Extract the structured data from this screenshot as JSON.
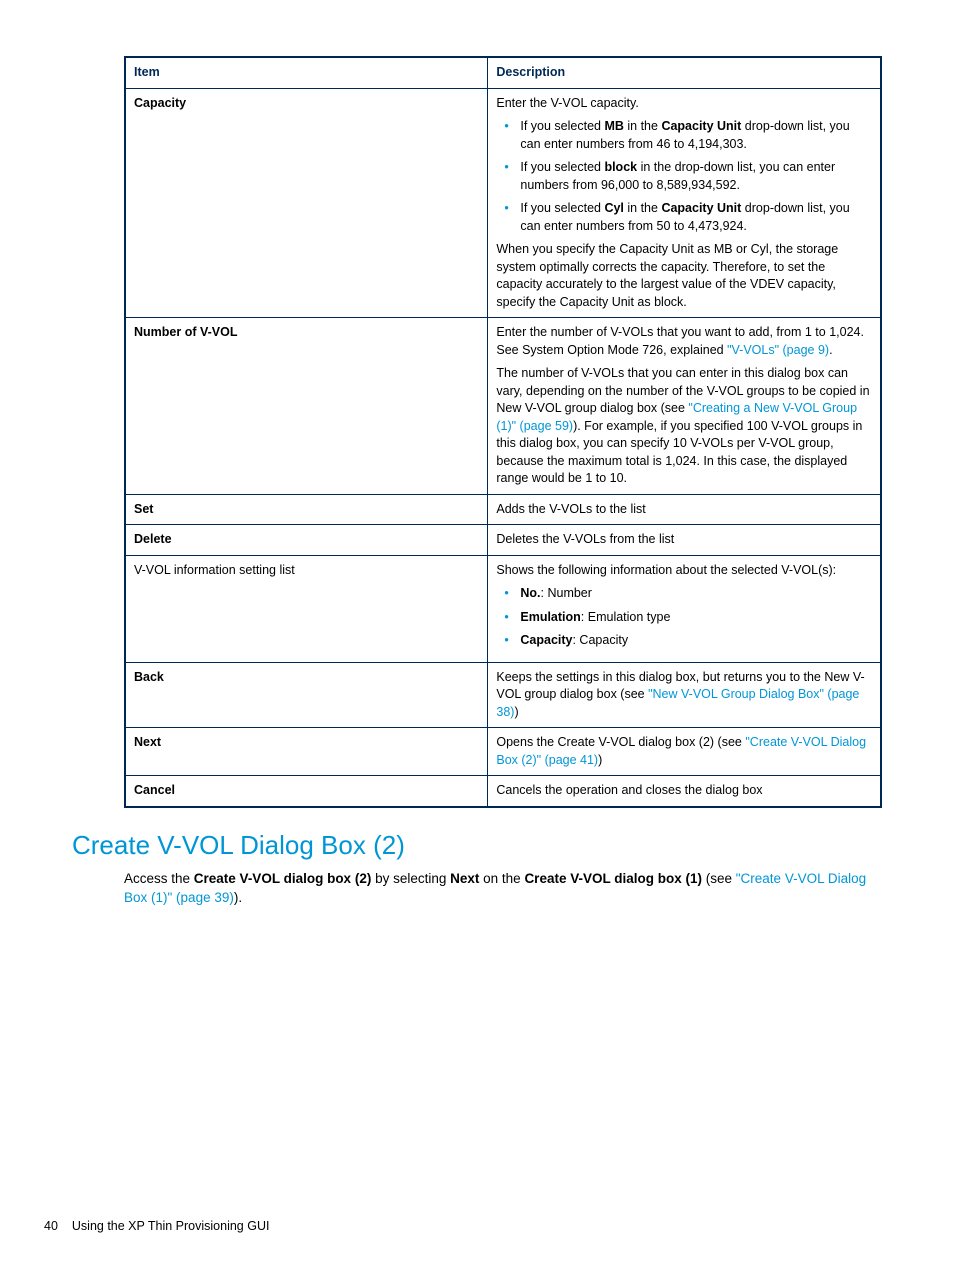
{
  "table": {
    "headers": {
      "item": "Item",
      "desc": "Description"
    },
    "rows": {
      "capacity": {
        "item": "Capacity",
        "p1": "Enter the V-VOL capacity.",
        "b1a": "If you selected ",
        "b1b": "MB",
        "b1c": " in the ",
        "b1d": "Capacity Unit",
        "b1e": " drop-down list, you can enter numbers from 46 to 4,194,303.",
        "b2a": "If you selected ",
        "b2b": "block",
        "b2c": " in the drop-down list, you can enter numbers from 96,000 to 8,589,934,592.",
        "b3a": "If you selected ",
        "b3b": "Cyl",
        "b3c": " in the ",
        "b3d": "Capacity Unit",
        "b3e": " drop-down list, you can enter numbers from 50 to 4,473,924.",
        "p2": "When you specify the Capacity Unit as MB or Cyl, the storage system optimally corrects the capacity. Therefore, to set the capacity accurately to the largest value of the VDEV capacity, specify the Capacity Unit as block."
      },
      "numvvol": {
        "item": "Number of V-VOL",
        "p1a": "Enter the number of V-VOLs that you want to add, from 1 to 1,024. See System Option Mode 726, explained ",
        "p1link": "\"V-VOLs\" (page 9)",
        "p1b": ".",
        "p2a": "The number of V-VOLs that you can enter in this dialog box can vary, depending on the number of the V-VOL groups to be copied in New V-VOL group dialog box (see ",
        "p2link": "\"Creating a New V-VOL Group (1)\" (page 59)",
        "p2b": "). For example, if you specified 100 V-VOL groups in this dialog box, you can specify 10 V-VOLs per V-VOL group, because the maximum total is 1,024. In this case, the displayed range would be 1 to 10."
      },
      "set": {
        "item": "Set",
        "desc": "Adds the V-VOLs to the list"
      },
      "delete": {
        "item": "Delete",
        "desc": "Deletes the V-VOLs from the list"
      },
      "vvolinfo": {
        "item": "V-VOL information setting list",
        "p1": "Shows the following information about the selected V-VOL(s):",
        "b1a": "No.",
        "b1b": ": Number",
        "b2a": "Emulation",
        "b2b": ": Emulation type",
        "b3a": "Capacity",
        "b3b": ": Capacity"
      },
      "back": {
        "item": "Back",
        "p1a": "Keeps the settings in this dialog box, but returns you to the New V-VOL group dialog box (see ",
        "p1link": "\"New V-VOL Group Dialog Box\" (page 38)",
        "p1b": ")"
      },
      "next": {
        "item": "Next",
        "p1a": "Opens the Create V-VOL dialog box (2) (see ",
        "p1link": "\"Create V-VOL Dialog Box (2)\" (page 41)",
        "p1b": ")"
      },
      "cancel": {
        "item": "Cancel",
        "desc": "Cancels the operation and closes the dialog box"
      }
    }
  },
  "section": {
    "title": "Create V-VOL Dialog Box (2)",
    "p1a": "Access the ",
    "p1b": "Create V-VOL dialog box (2)",
    "p1c": " by selecting ",
    "p1d": "Next",
    "p1e": " on the ",
    "p1f": "Create V-VOL dialog box (1)",
    "p1g": " (see ",
    "p1link": "\"Create V-VOL Dialog Box (1)\" (page 39)",
    "p1h": ")."
  },
  "footer": {
    "page": "40",
    "title": "Using the XP Thin Provisioning GUI"
  }
}
